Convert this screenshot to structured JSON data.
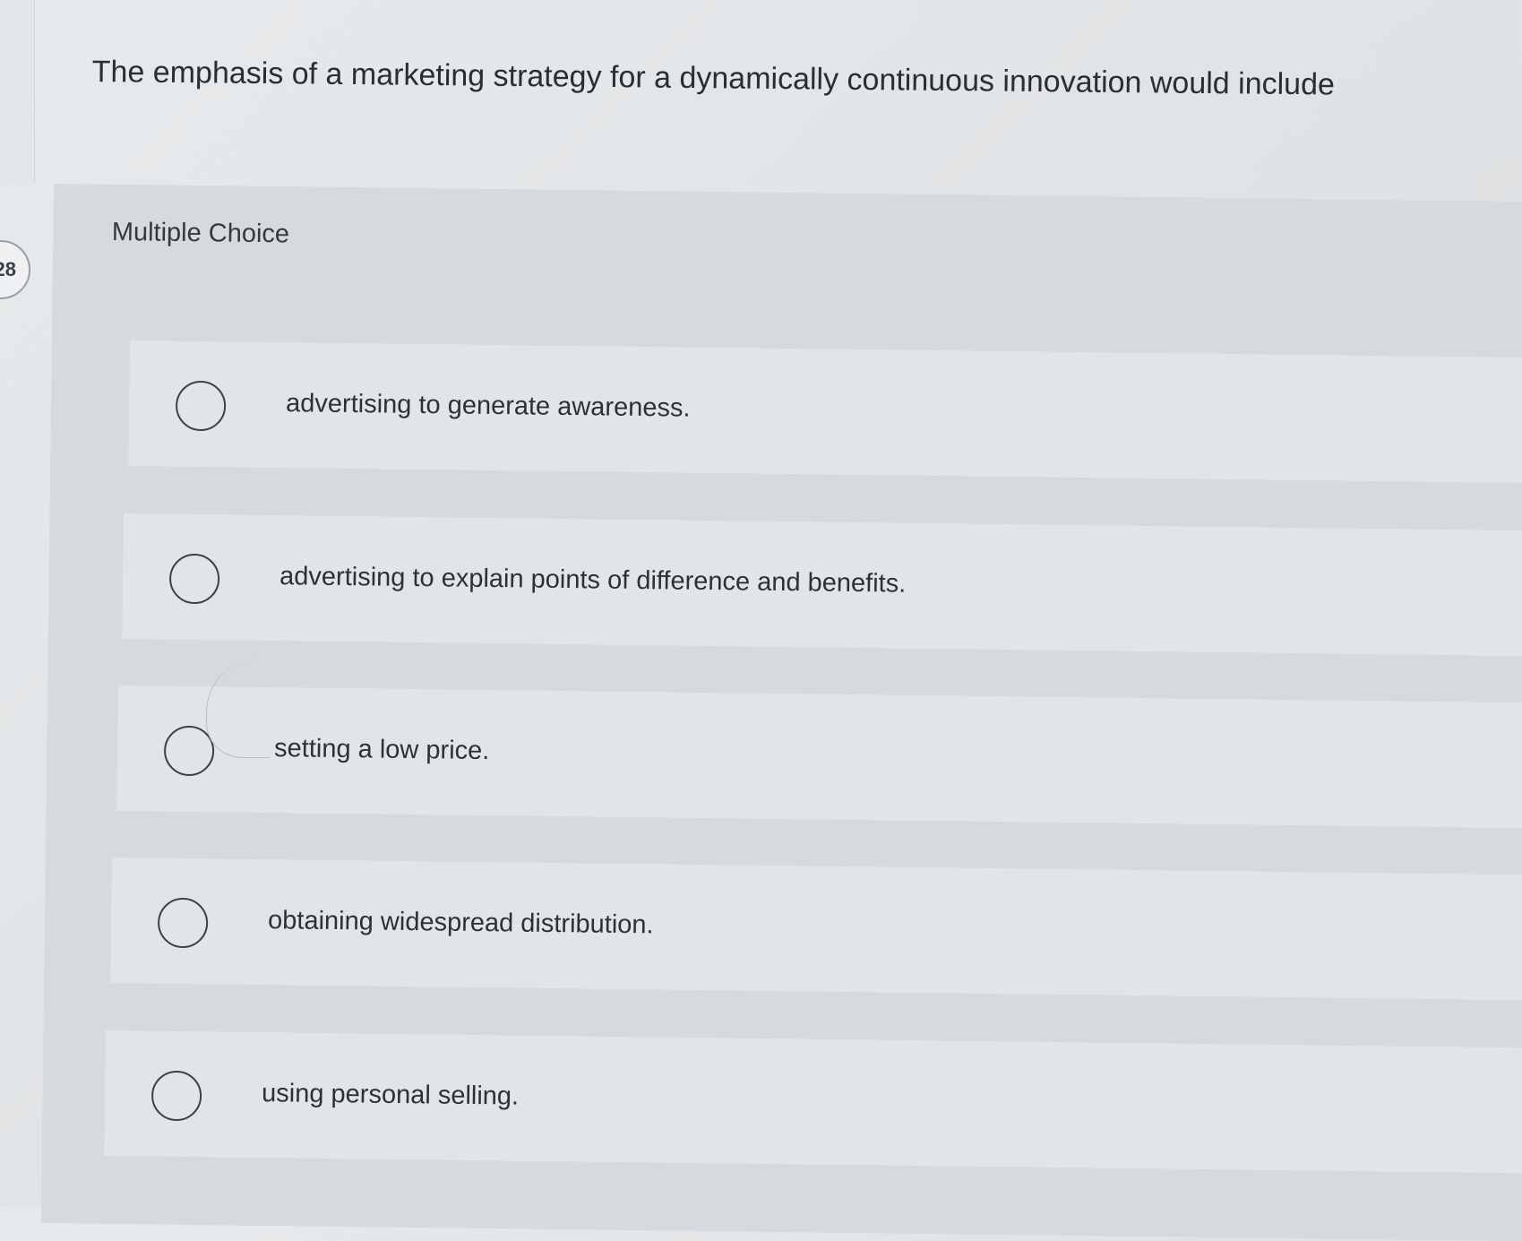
{
  "question": {
    "number": "28",
    "text": "The emphasis of a marketing strategy for a dynamically continuous innovation would include"
  },
  "panel": {
    "header": "Multiple Choice"
  },
  "options": [
    {
      "label": "advertising to generate awareness.",
      "selected": false
    },
    {
      "label": "advertising to explain points of difference and benefits.",
      "selected": false
    },
    {
      "label": "setting a low price.",
      "selected": false
    },
    {
      "label": "obtaining widespread distribution.",
      "selected": false
    },
    {
      "label": "using personal selling.",
      "selected": false
    }
  ]
}
